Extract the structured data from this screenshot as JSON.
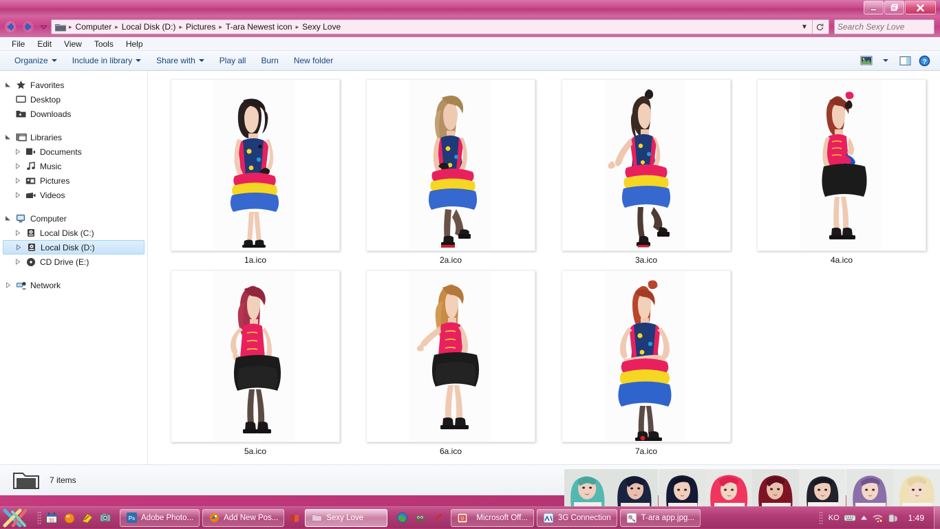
{
  "window": {
    "controls": {
      "minimize": "minimize-button",
      "restore": "restore-button",
      "close": "close-button"
    }
  },
  "address": {
    "folder_icon": "folder-icon",
    "back": "back-arrow-icon",
    "forward": "forward-arrow-icon",
    "recent": "recent-pages-chevron-icon",
    "crumbs": [
      "Computer",
      "Local Disk (D:)",
      "Pictures",
      "T-ara Newest icon",
      "Sexy Love"
    ],
    "separator": "▸",
    "history_caret": "▼",
    "refresh": "refresh-icon"
  },
  "search": {
    "placeholder": "Search Sexy Love",
    "value": "",
    "icon": "search-icon"
  },
  "menu": {
    "items": [
      "File",
      "Edit",
      "View",
      "Tools",
      "Help"
    ]
  },
  "toolbar": {
    "items": [
      {
        "label": "Organize",
        "caret": true
      },
      {
        "label": "Include in library",
        "caret": true
      },
      {
        "label": "Share with",
        "caret": true
      },
      {
        "label": "Play all",
        "caret": false
      },
      {
        "label": "Burn",
        "caret": false
      },
      {
        "label": "New folder",
        "caret": false
      }
    ],
    "view_icon": "views-picture-icon",
    "view_caret": "▼",
    "preview_pane_icon": "preview-pane-icon",
    "help_icon": "help-icon"
  },
  "navpane": {
    "groups": [
      {
        "header": {
          "label": "Favorites",
          "icon": "star-icon",
          "twisty": "expanded"
        },
        "items": [
          {
            "label": "Desktop",
            "icon": "desktop-icon",
            "twisty": "none"
          },
          {
            "label": "Downloads",
            "icon": "downloads-folder-icon",
            "twisty": "none"
          }
        ]
      },
      {
        "header": {
          "label": "Libraries",
          "icon": "libraries-icon",
          "twisty": "expanded"
        },
        "items": [
          {
            "label": "Documents",
            "icon": "documents-library-icon",
            "twisty": "collapsed"
          },
          {
            "label": "Music",
            "icon": "music-library-icon",
            "twisty": "collapsed"
          },
          {
            "label": "Pictures",
            "icon": "pictures-library-icon",
            "twisty": "collapsed"
          },
          {
            "label": "Videos",
            "icon": "videos-library-icon",
            "twisty": "collapsed"
          }
        ]
      },
      {
        "header": {
          "label": "Computer",
          "icon": "computer-icon",
          "twisty": "expanded"
        },
        "items": [
          {
            "label": "Local Disk (C:)",
            "icon": "hard-disk-icon",
            "twisty": "collapsed",
            "selected": false
          },
          {
            "label": "Local Disk (D:)",
            "icon": "hard-disk-icon",
            "twisty": "collapsed",
            "selected": true
          },
          {
            "label": "CD Drive (E:)",
            "icon": "cd-drive-icon",
            "twisty": "collapsed",
            "selected": false
          }
        ]
      },
      {
        "header": {
          "label": "Network",
          "icon": "network-icon",
          "twisty": "collapsed"
        },
        "items": []
      }
    ]
  },
  "files": [
    {
      "name": "1a.ico",
      "thumb": "idol-standing-colorful-ruffle-dress"
    },
    {
      "name": "2a.ico",
      "thumb": "idol-leg-raised-colorful-ruffle-dress"
    },
    {
      "name": "3a.ico",
      "thumb": "idol-side-pose-colorful-ruffle-dress"
    },
    {
      "name": "4a.ico",
      "thumb": "idol-pink-top-black-skirt"
    },
    {
      "name": "5a.ico",
      "thumb": "idol-red-hair-pink-top-black-tutu"
    },
    {
      "name": "6a.ico",
      "thumb": "idol-arm-out-pink-top-black-skirt"
    },
    {
      "name": "7a.ico",
      "thumb": "idol-hands-on-hips-ruffle-dress"
    }
  ],
  "statusbar": {
    "folder_icon": "folder-large-icon",
    "text": "7 items"
  },
  "photostrip": {
    "name": "wallpaper-portrait-strip",
    "portraits": [
      {
        "hair": "#54b8b0",
        "skin": "#f0cfc0"
      },
      {
        "hair": "#1a2340",
        "skin": "#e8bfae"
      },
      {
        "hair": "#141a33",
        "skin": "#f1cdbb"
      },
      {
        "hair": "#f0355e",
        "skin": "#f2d4c4"
      },
      {
        "hair": "#7e1424",
        "skin": "#e9bfad"
      },
      {
        "hair": "#23212c",
        "skin": "#efccba"
      },
      {
        "hair": "#8a6fa8",
        "skin": "#f3d6c6"
      },
      {
        "hair": "#efe0b6",
        "skin": "#f4dccb"
      }
    ]
  },
  "taskbar": {
    "start_label": "start-orb",
    "quicklaunch": [
      {
        "name": "calendar-icon"
      },
      {
        "name": "orange-orb-icon"
      },
      {
        "name": "yellow-note-icon"
      },
      {
        "name": "camera-icon"
      }
    ],
    "buttons": [
      {
        "label": "Adobe Photo...",
        "icon": "photoshop-icon",
        "active": false
      },
      {
        "label": "Add New Pos...",
        "icon": "firefox-icon",
        "active": false
      },
      {
        "label": "Sexy Love",
        "icon": "folder-icon",
        "active": true
      },
      {
        "label": "Microsoft Off...",
        "icon": "office-icon",
        "active": false
      },
      {
        "label": "3G Connection",
        "icon": "modem-icon",
        "active": false
      },
      {
        "label": "T-ara app.jpg...",
        "icon": "paint-icon",
        "active": false
      }
    ],
    "middle_icons": [
      {
        "name": "earth-icon"
      },
      {
        "name": "gimp-icon"
      },
      {
        "name": "red-swoosh-icon"
      },
      {
        "name": "red-book-icon"
      }
    ],
    "tray": {
      "language": "KO",
      "icons": [
        "keyboard-icon",
        "show-hidden-icons-arrow",
        "network-disconnected-icon",
        "battery-icon"
      ],
      "clock": "1:49"
    }
  },
  "colors": {
    "title_pink": "#c4387e",
    "taskbar_pink": "#b23d76",
    "accent_blue": "#16457e",
    "selection_blue": "#c9e3f8"
  }
}
